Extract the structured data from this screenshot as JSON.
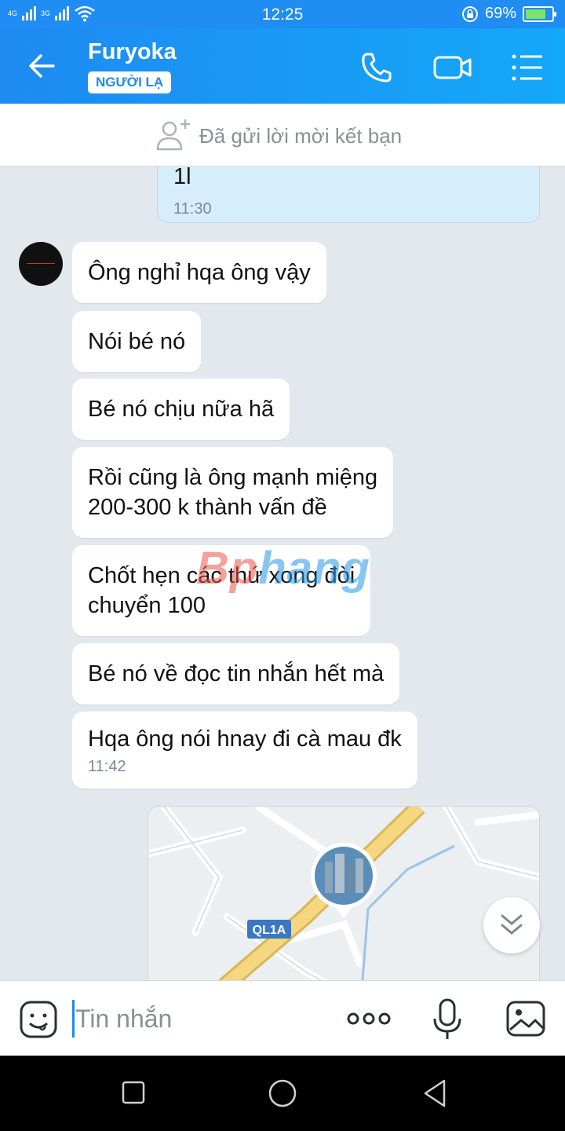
{
  "status_bar": {
    "network_1": "4G",
    "network_2": "3G",
    "time": "12:25",
    "battery_percent": "69%",
    "battery_level": 0.69,
    "icons": [
      "signal-icon",
      "wifi-icon",
      "rotation-lock-icon",
      "battery-icon"
    ]
  },
  "header": {
    "name": "Furyoka",
    "badge": "NGƯỜI LẠ",
    "icons": [
      "back-arrow-icon",
      "phone-icon",
      "video-call-icon",
      "menu-list-icon"
    ],
    "background_color": "#1e8af2"
  },
  "friend_request": {
    "text": "Đã gửi lời mời kết bạn",
    "icon": "add-friend-icon"
  },
  "messages": {
    "outgoing": {
      "text": "1l",
      "time": "11:30"
    },
    "incoming": [
      {
        "lines": [
          "Ông nghỉ hqa ông vậy"
        ]
      },
      {
        "lines": [
          "Nói bé nó"
        ]
      },
      {
        "lines": [
          "Bé nó chịu nữa hã"
        ]
      },
      {
        "lines": [
          "Rồi cũng là ông mạnh miệng",
          "200-300 k thành vấn đề"
        ]
      },
      {
        "lines": [
          "Chốt hẹn các thứ xong đòi",
          "chuyển 100"
        ]
      },
      {
        "lines": [
          "Bé nó về đọc tin nhắn hết mà"
        ]
      },
      {
        "lines": [
          "Hqa ông nói hnay đi cà mau đk"
        ],
        "time": "11:42"
      }
    ]
  },
  "watermark": {
    "part1": "Bp",
    "part2": "hang"
  },
  "map": {
    "road_label": "QL1A"
  },
  "input": {
    "placeholder": "Tin nhắn",
    "icons": [
      "emoji-icon",
      "more-icon",
      "microphone-icon",
      "image-icon"
    ]
  },
  "nav_bar": {
    "icons": [
      "recent-apps-icon",
      "home-icon",
      "back-icon"
    ]
  }
}
